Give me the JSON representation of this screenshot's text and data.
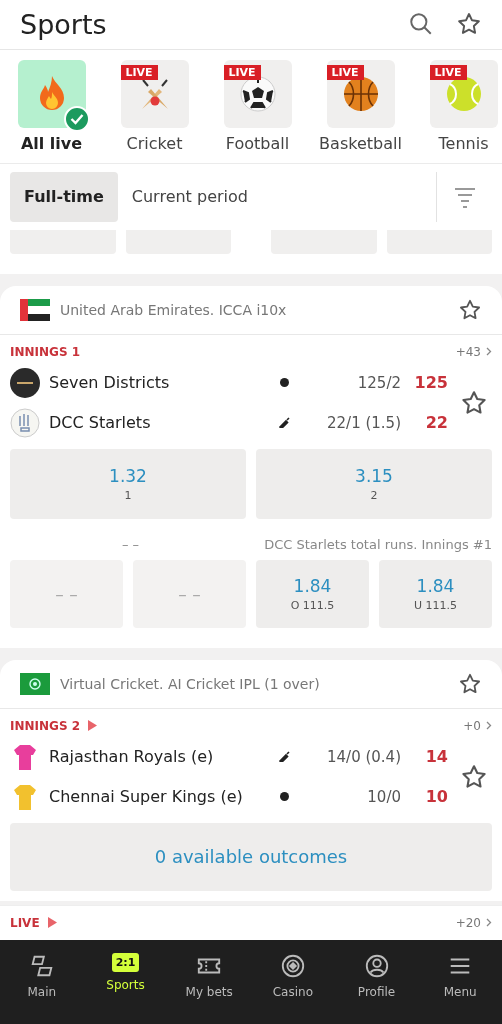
{
  "header": {
    "title": "Sports"
  },
  "sports": [
    {
      "kind": "all",
      "label": "All live",
      "live": false,
      "selected": true
    },
    {
      "kind": "cricket",
      "label": "Cricket",
      "live": true,
      "badge": "LIVE",
      "selected": false
    },
    {
      "kind": "football",
      "label": "Football",
      "live": true,
      "badge": "LIVE",
      "selected": false
    },
    {
      "kind": "basketball",
      "label": "Basketball",
      "live": true,
      "badge": "LIVE",
      "selected": false
    },
    {
      "kind": "tennis",
      "label": "Tennis",
      "live": true,
      "badge": "LIVE",
      "selected": false
    }
  ],
  "period_tabs": [
    {
      "label": "Full-time",
      "selected": true
    },
    {
      "label": "Current period",
      "selected": false
    }
  ],
  "events": [
    {
      "flag": {
        "kind": "uae"
      },
      "league": "United Arab Emirates. ICCA i10x",
      "stage": "INNINGS 1",
      "streaming": false,
      "more": "+43",
      "teams": [
        {
          "name": "Seven Districts",
          "logo": {
            "kind": "dark"
          },
          "indicator": {
            "kind": "ball"
          },
          "score": "125/2",
          "runs": "125"
        },
        {
          "name": "DCC Starlets",
          "logo": {
            "kind": "crest"
          },
          "indicator": {
            "kind": "bat"
          },
          "score": "22/1 (1.5)",
          "runs": "22"
        }
      ],
      "main_odds": [
        {
          "odd": "1.32",
          "label": "1"
        },
        {
          "odd": "3.15",
          "label": "2"
        }
      ],
      "market": {
        "left_title": "– –",
        "right_title": "DCC Starlets total runs. Innings #1",
        "odds": [
          {
            "empty": true,
            "odd": "– –"
          },
          {
            "empty": true,
            "odd": "– –"
          },
          {
            "empty": false,
            "odd": "1.84",
            "label": "O 111.5"
          },
          {
            "empty": false,
            "odd": "1.84",
            "label": "U 111.5"
          }
        ]
      }
    },
    {
      "flag": {
        "kind": "virtual"
      },
      "league": "Virtual Cricket. AI Cricket IPL (1 over)",
      "stage": "INNINGS 2",
      "streaming": true,
      "more": "+0",
      "teams": [
        {
          "name": "Rajasthan Royals (e)",
          "logo": {
            "kind": "jersey"
          },
          "color": "#e83e9c",
          "indicator": {
            "kind": "bat"
          },
          "score": "14/0 (0.4)",
          "runs": "14"
        },
        {
          "name": "Chennai Super Kings (e)",
          "logo": {
            "kind": "jersey"
          },
          "color": "#f2c12e",
          "indicator": {
            "kind": "ball"
          },
          "score": "10/0",
          "runs": "10"
        }
      ],
      "outcomes": "0 available outcomes"
    }
  ],
  "next_event": {
    "stage": "LIVE",
    "streaming": true,
    "more": "+20"
  },
  "nav": [
    {
      "kind": "main",
      "label": "Main",
      "selected": false
    },
    {
      "kind": "sports",
      "label": "Sports",
      "icon_text": "2:1",
      "selected": true
    },
    {
      "kind": "bets",
      "label": "My bets",
      "selected": false
    },
    {
      "kind": "casino",
      "label": "Casino",
      "selected": false
    },
    {
      "kind": "profile",
      "label": "Profile",
      "selected": false
    },
    {
      "kind": "menu",
      "label": "Menu",
      "selected": false
    }
  ]
}
